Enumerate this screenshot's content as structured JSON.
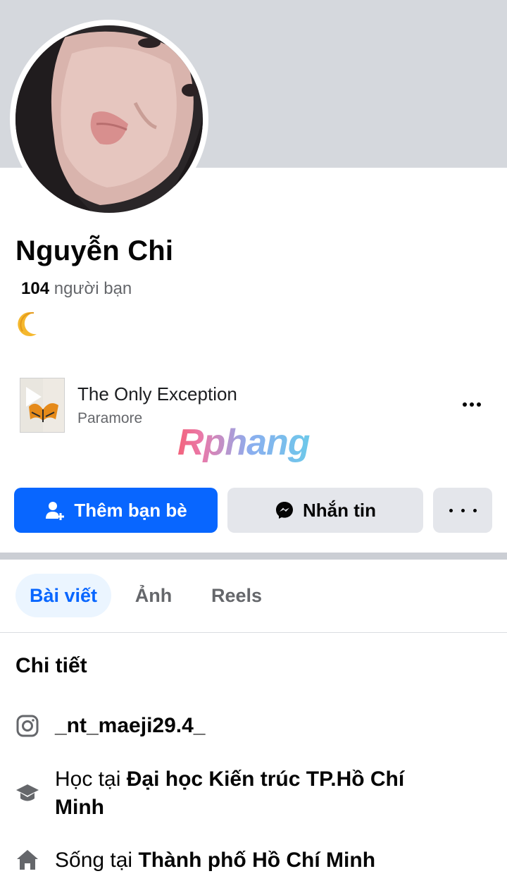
{
  "profile": {
    "name": "Nguyễn Chi",
    "friends_count": "104",
    "friends_label": "người bạn",
    "bio_emoji": "🌙"
  },
  "music": {
    "song_title": "The Only Exception",
    "artist": "Paramore"
  },
  "watermark": "Rphang",
  "actions": {
    "add_friend_label": "Thêm bạn bè",
    "message_label": "Nhắn tin"
  },
  "tabs": [
    {
      "label": "Bài viết",
      "active": true
    },
    {
      "label": "Ảnh",
      "active": false
    },
    {
      "label": "Reels",
      "active": false
    }
  ],
  "details": {
    "title": "Chi tiết",
    "instagram": "_nt_maeji29.4_",
    "study_prefix": "Học tại",
    "study_place": "Đại học Kiến trúc TP.Hồ Chí Minh",
    "live_prefix": "Sống tại",
    "live_place": "Thành phố Hồ Chí Minh"
  },
  "colors": {
    "primary_blue": "#0866ff",
    "secondary_button": "#e4e6eb",
    "active_tab_bg": "#ebf5ff",
    "cover_gray": "#d5d8dd",
    "muted_text": "#65676b"
  },
  "icons": {
    "add_friend": "person-plus-icon",
    "message": "messenger-icon",
    "more": "more-dots-icon",
    "instagram": "instagram-icon",
    "study": "graduation-cap-icon",
    "live": "home-icon"
  }
}
